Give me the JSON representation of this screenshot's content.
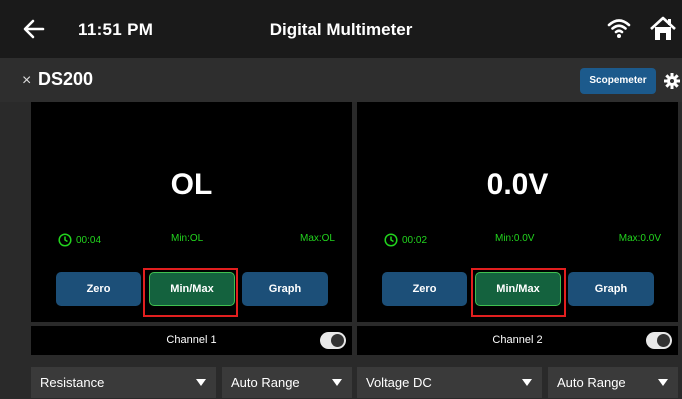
{
  "header": {
    "time": "11:51 PM",
    "title": "Digital Multimeter",
    "icons": [
      "back-arrow-icon",
      "wifi-icon",
      "home-icon"
    ]
  },
  "toolbar": {
    "close": "×",
    "device_name": "DS200",
    "scopemeter_label": "Scopemeter",
    "icons": [
      "gear-icon"
    ],
    "accent_color": "#1c5a8c"
  },
  "channels": [
    {
      "reading": "OL",
      "timer": "00:04",
      "min": "Min:OL",
      "max": "Max:OL",
      "buttons": {
        "zero": "Zero",
        "minmax": "Min/Max",
        "graph": "Graph"
      },
      "channel_label": "Channel 1",
      "enabled": true,
      "mode": "Resistance",
      "range": "Auto Range"
    },
    {
      "reading": "0.0V",
      "timer": "00:02",
      "min": "Min:0.0V",
      "max": "Max:0.0V",
      "buttons": {
        "zero": "Zero",
        "minmax": "Min/Max",
        "graph": "Graph"
      },
      "channel_label": "Channel 2",
      "enabled": true,
      "mode": "Voltage DC",
      "range": "Auto Range"
    }
  ],
  "colors": {
    "stat_green": "#22d41e",
    "button_blue": "#1c4f78",
    "minmax_green": "#14623e",
    "highlight_red": "#e21f1f"
  }
}
